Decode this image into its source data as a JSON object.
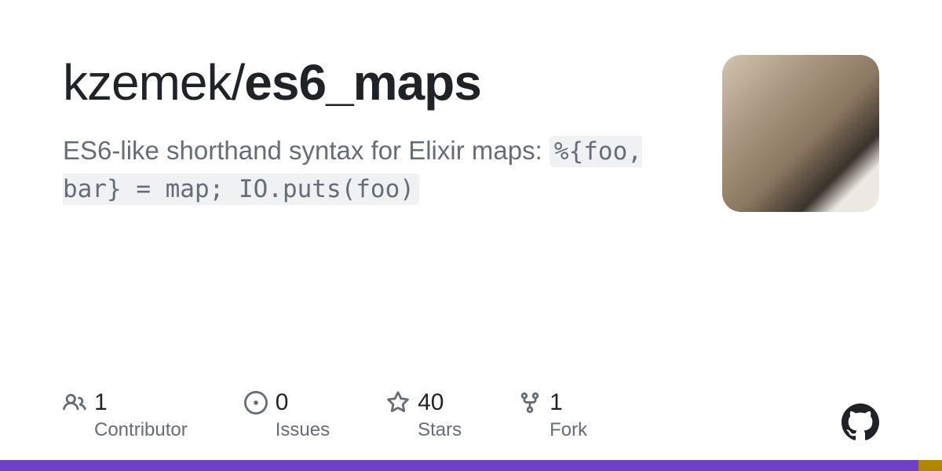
{
  "repo": {
    "owner": "kzemek",
    "name": "es6_maps",
    "description_prefix": "ES6-like shorthand syntax for Elixir maps: ",
    "description_code": "%{foo, bar} = map; IO.puts(foo)"
  },
  "stats": {
    "contributors": {
      "value": "1",
      "label": "Contributor"
    },
    "issues": {
      "value": "0",
      "label": "Issues"
    },
    "stars": {
      "value": "40",
      "label": "Stars"
    },
    "forks": {
      "value": "1",
      "label": "Fork"
    }
  }
}
